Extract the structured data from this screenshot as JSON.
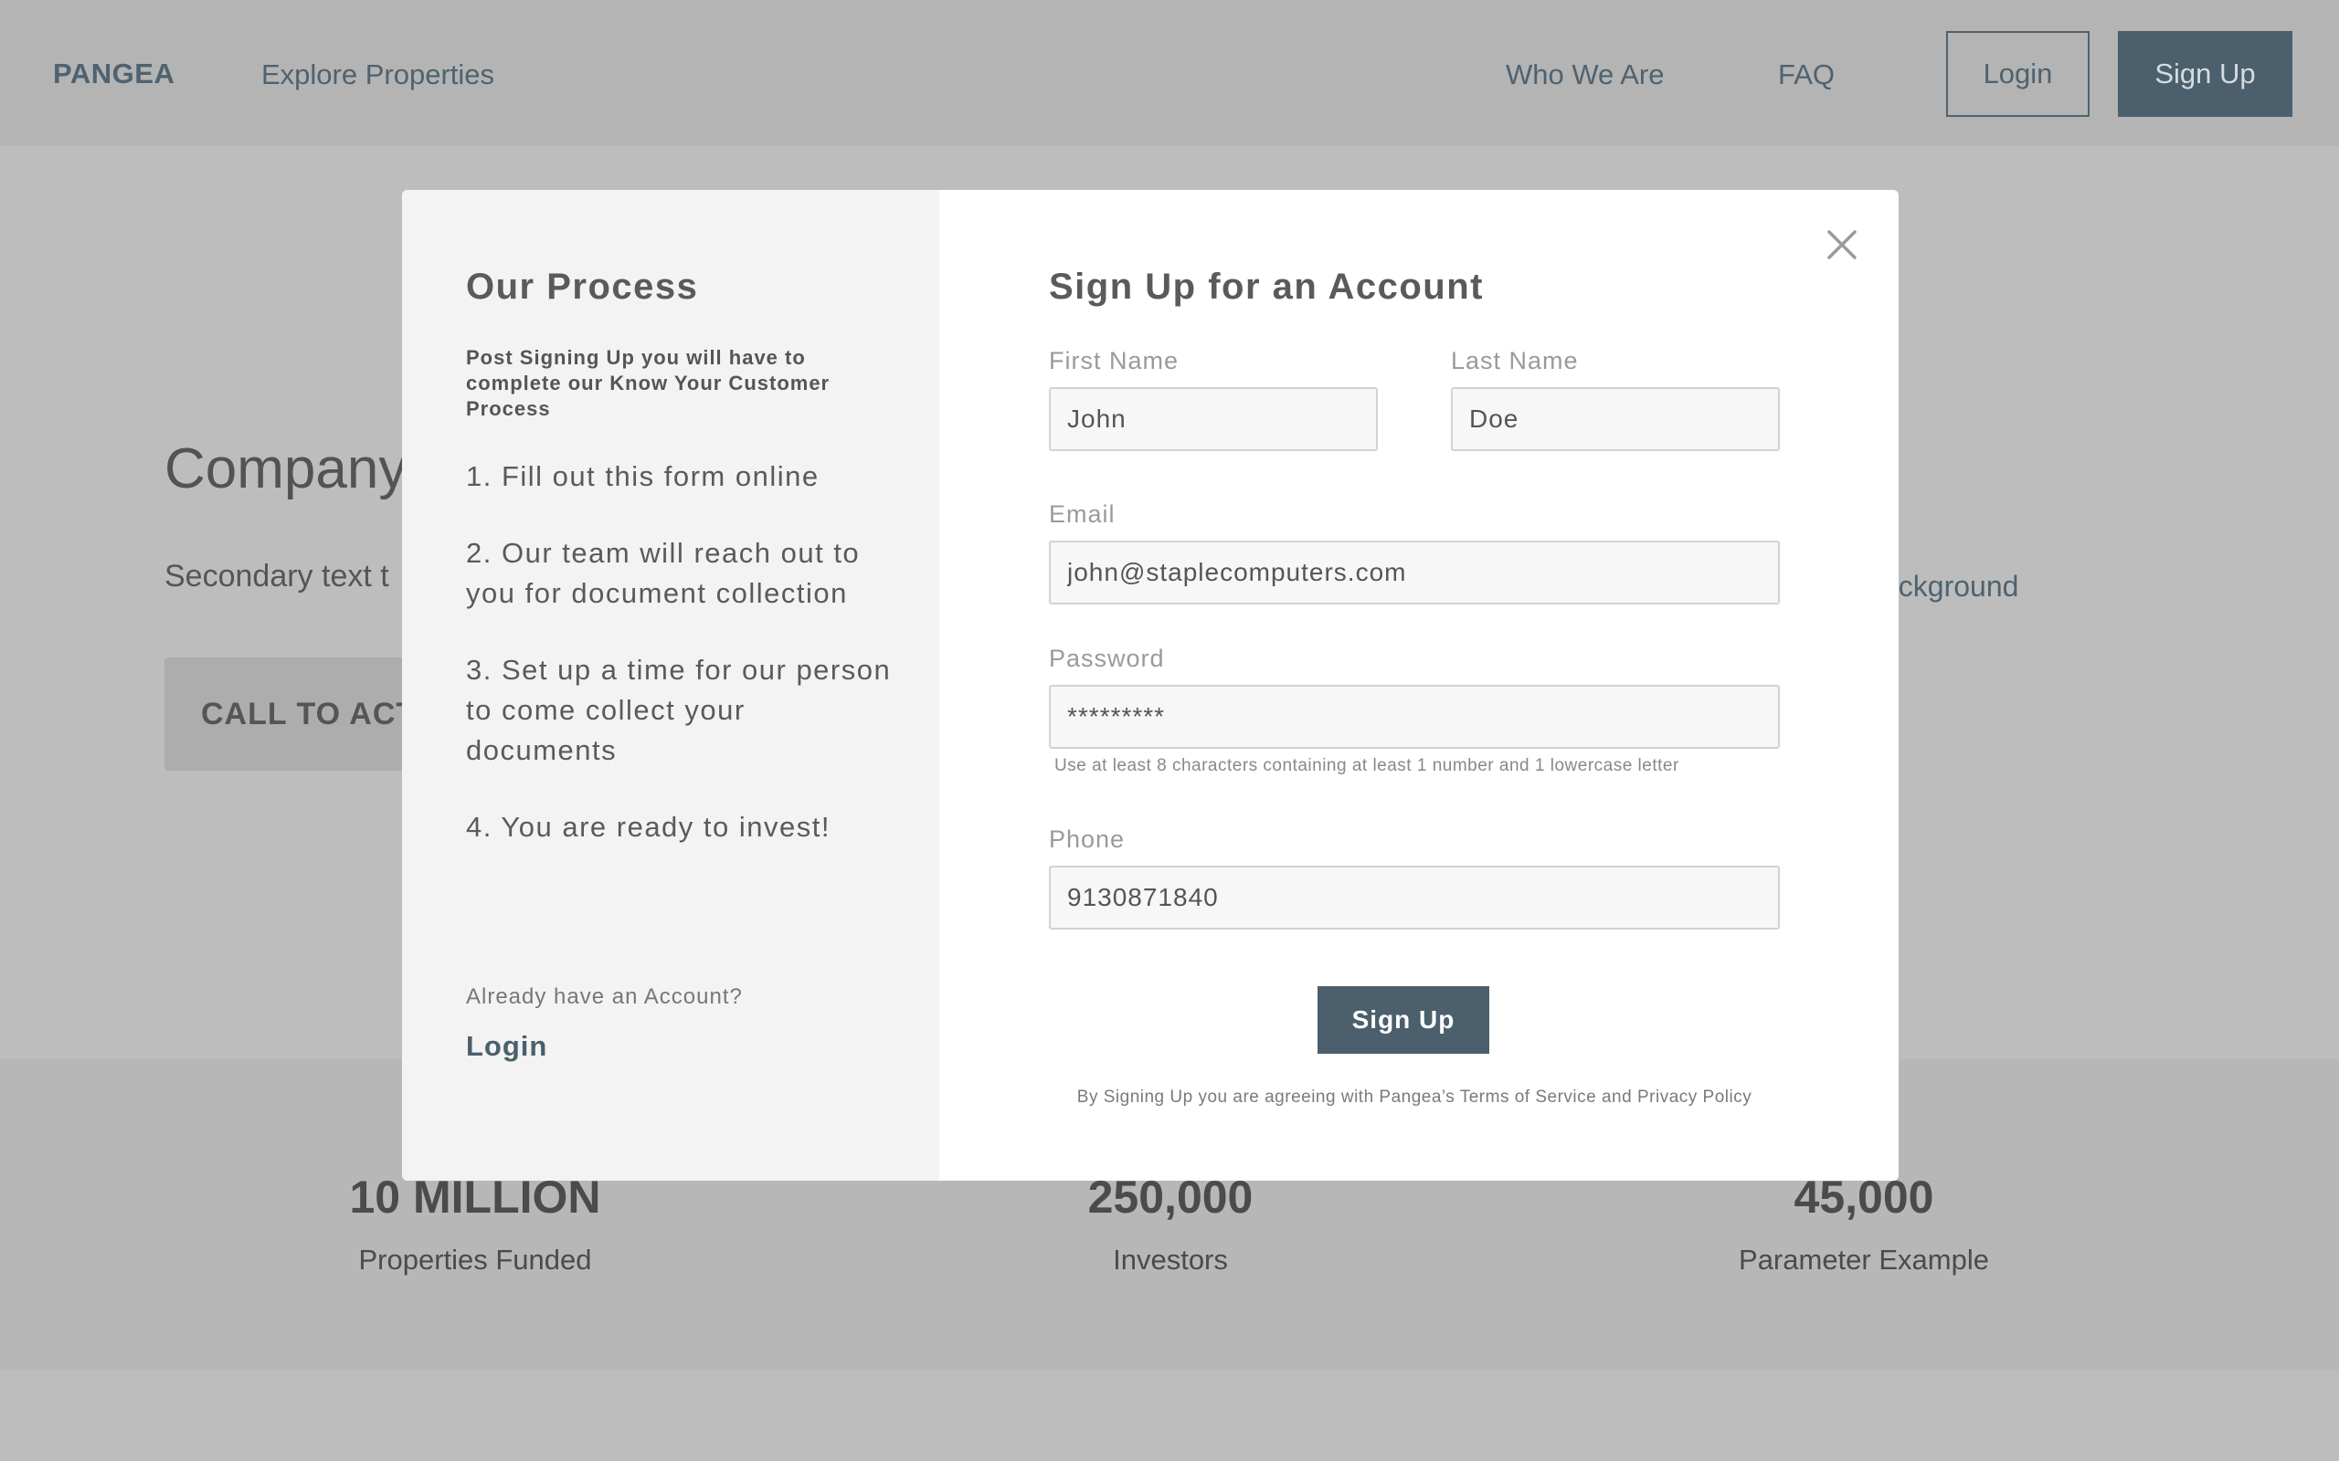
{
  "nav": {
    "brand": "PANGEA",
    "explore": "Explore Properties",
    "who": "Who We Are",
    "faq": "FAQ",
    "login": "Login",
    "signup": "Sign Up"
  },
  "hero": {
    "title": "Company",
    "subtitle": "Secondary text t",
    "subtitle_right": "ackground",
    "cta": "CALL TO ACT"
  },
  "stats": [
    {
      "value": "10 MILLION",
      "label": "Properties Funded"
    },
    {
      "value": "250,000",
      "label": "Investors"
    },
    {
      "value": "45,000",
      "label": "Parameter Example"
    }
  ],
  "modal": {
    "process_title": "Our Process",
    "process_intro": "Post Signing Up you will have to complete our Know Your Customer Process",
    "steps": [
      "1. Fill out this form online",
      "2. Our team will reach out to you for document collection",
      "3. Set up a time for our person to come collect your documents",
      "4. You are ready to invest!"
    ],
    "already_account": "Already have an Account?",
    "login_link": "Login",
    "form_title": "Sign Up for an Account",
    "first_name": {
      "label": "First Name",
      "value": "John"
    },
    "last_name": {
      "label": "Last Name",
      "value": "Doe"
    },
    "email": {
      "label": "Email",
      "value": "john@staplecomputers.com"
    },
    "password": {
      "label": "Password",
      "value": "*********",
      "hint": "Use at least 8 characters containing at least 1 number and 1 lowercase letter"
    },
    "phone": {
      "label": "Phone",
      "value": "9130871840"
    },
    "submit": "Sign Up",
    "terms": "By Signing Up you are agreeing with Pangea’s Terms of Service and Privacy Policy",
    "close_icon": "close-icon"
  },
  "colors": {
    "accent": "#4b5f6c",
    "overlay": "#bdbdbd"
  }
}
